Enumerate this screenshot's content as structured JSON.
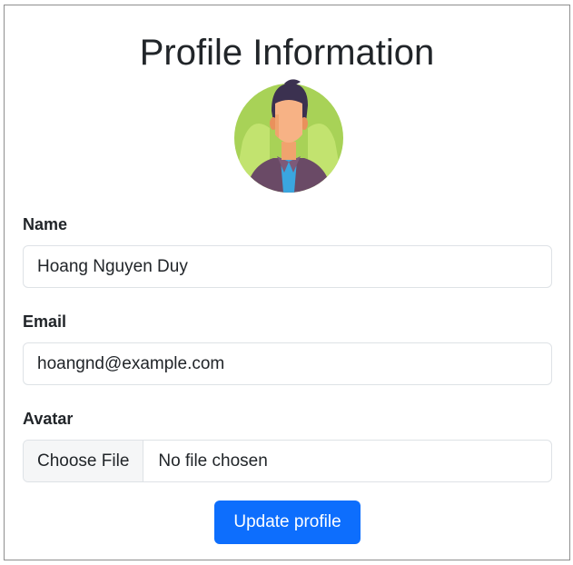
{
  "page": {
    "title": "Profile Information"
  },
  "avatar": {
    "icon": "user-avatar-icon"
  },
  "form": {
    "name_label": "Name",
    "name_value": "Hoang Nguyen Duy",
    "email_label": "Email",
    "email_value": "hoangnd@example.com",
    "avatar_label": "Avatar",
    "file_button_label": "Choose File",
    "file_status": "No file chosen",
    "submit_label": "Update profile"
  },
  "colors": {
    "primary": "#0d6efd",
    "border": "#dee2e6",
    "avatar_bg": "#a8d257",
    "avatar_shirt": "#6a4a66"
  }
}
